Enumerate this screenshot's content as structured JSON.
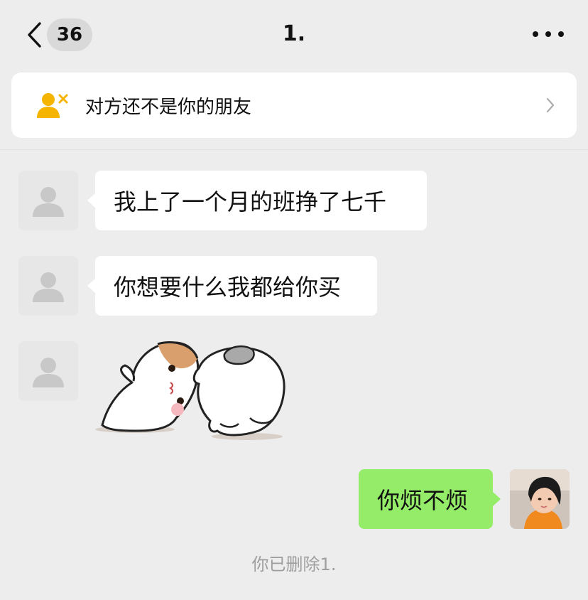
{
  "nav": {
    "unread_count": "36",
    "title": "1."
  },
  "notice": {
    "text": "对方还不是你的朋友"
  },
  "messages": [
    {
      "sender": "other",
      "text": "我上了一个月的班挣了七千"
    },
    {
      "sender": "other",
      "text": "你想要什么我都给你买"
    },
    {
      "sender": "other",
      "type": "sticker"
    },
    {
      "sender": "me",
      "text": "你烦不烦"
    }
  ],
  "system_note": "你已删除1.",
  "icons": {
    "back": "chevron-left-icon",
    "more": "more-dots-icon",
    "notice": "user-remove-icon",
    "notice_arrow": "chevron-right-icon",
    "placeholder_avatar": "user-silhouette-icon"
  },
  "colors": {
    "background": "#ededed",
    "my_bubble": "#95ec69",
    "their_bubble": "#ffffff",
    "notice_icon": "#f5b400"
  }
}
